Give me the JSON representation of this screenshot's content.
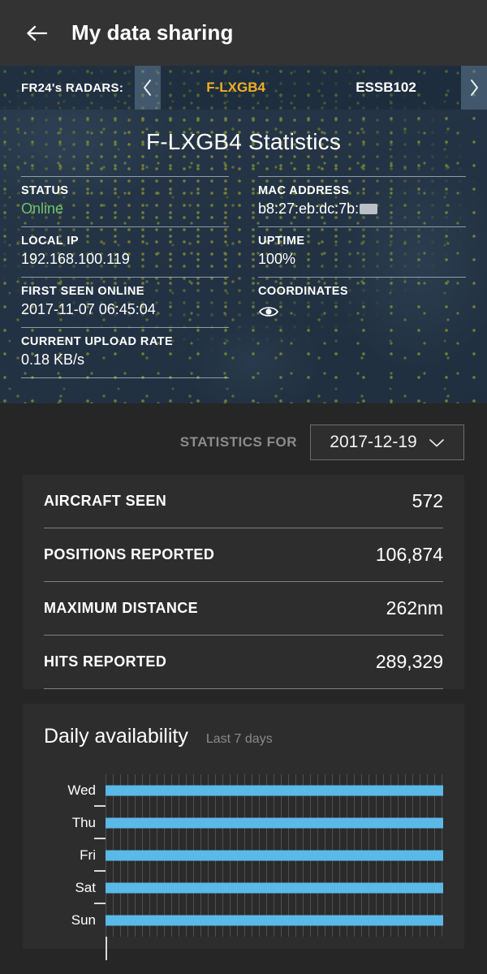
{
  "appbar": {
    "back_icon": "arrow-left-icon",
    "title": "My data sharing"
  },
  "radar_strip": {
    "label": "FR24's RADARS:",
    "prev_icon": "chevron-left-icon",
    "next_icon": "chevron-right-icon",
    "radars": [
      {
        "name": "F-LXGB4",
        "active": true
      },
      {
        "name": "ESSB102",
        "active": false
      }
    ]
  },
  "hero": {
    "title": "F-LXGB4 Statistics",
    "left_fields": [
      {
        "key": "STATUS",
        "value": "Online",
        "style": "online"
      },
      {
        "key": "LOCAL IP",
        "value": "192.168.100.119",
        "style": "plain"
      },
      {
        "key": "FIRST SEEN ONLINE",
        "value": "2017-11-07 06:45:04",
        "style": "plain"
      },
      {
        "key": "CURRENT UPLOAD RATE",
        "value": "0.18 KB/s",
        "style": "plain"
      }
    ],
    "right_fields": [
      {
        "key": "MAC ADDRESS",
        "value": "b8:27:eb:dc:7b:",
        "style": "redacted"
      },
      {
        "key": "UPTIME",
        "value": "100%",
        "style": "plain"
      },
      {
        "key": "COORDINATES",
        "value": "",
        "style": "eye"
      }
    ],
    "coordinates_icon": "eye-icon"
  },
  "stats_for": {
    "label": "STATISTICS FOR",
    "selected_date": "2017-12-19",
    "chevron_icon": "chevron-down-icon"
  },
  "stats": {
    "rows": [
      {
        "key": "AIRCRAFT SEEN",
        "value": "572"
      },
      {
        "key": "POSITIONS REPORTED",
        "value": "106,874"
      },
      {
        "key": "MAXIMUM DISTANCE",
        "value": "262nm"
      },
      {
        "key": "HITS REPORTED",
        "value": "289,329"
      }
    ]
  },
  "chart_data": {
    "type": "bar",
    "title": "Daily availability",
    "subtitle": "Last 7 days",
    "xlabel": "",
    "ylabel": "",
    "grid": true,
    "legend": "none",
    "orientation": "horizontal",
    "categories": [
      "Wed",
      "Thu",
      "Fri",
      "Sat",
      "Sun"
    ],
    "values": [
      100,
      100,
      100,
      100,
      100
    ],
    "ylim": [
      0,
      100
    ],
    "unit": "percent-of-day-online",
    "note": "Each row is a full-width bar indicating 100% uptime for that day"
  },
  "colors": {
    "accent_bar": "#5bb9e8",
    "active_radar": "#f0ae27",
    "online_status": "#6ec36e",
    "appbar_bg": "#333333",
    "page_bg": "#262626",
    "card_bg": "#2d2d2d"
  }
}
